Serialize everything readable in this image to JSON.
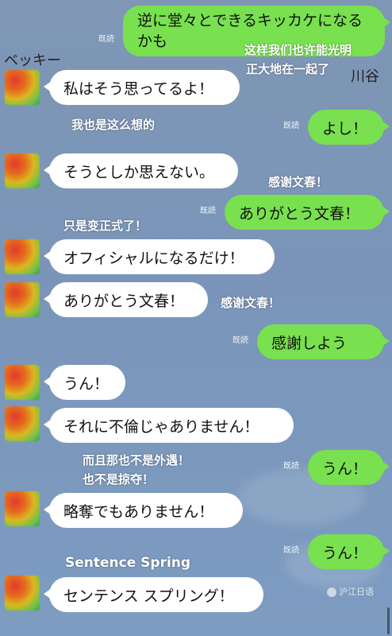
{
  "read_label": "既読",
  "speakers": {
    "left": "ベッキー",
    "right": "川谷"
  },
  "messages": {
    "m1": "逆に堂々とできるキッカケになるかも",
    "m2": "私はそう思ってるよ！",
    "m3": "よし！",
    "m4": "そうとしか思えない。",
    "m5": "ありがとう文春！",
    "m6": "オフィシャルになるだけ！",
    "m7": "ありがとう文春！",
    "m8": "感謝しよう",
    "m9": "うん！",
    "m10": "それに不倫じゃありません！",
    "m11": "うん！",
    "m12": "略奪でもありません！",
    "m13": "うん！",
    "m14": "センテンス スプリング！"
  },
  "subtitles": {
    "s1a": "这样我们也许能光明",
    "s1b": "正大地在一起了",
    "s2": "我也是这么想的",
    "s3": "感谢文春！",
    "s4": "只是变正式了！",
    "s5": "感谢文春！",
    "s6a": "而且那也不是外遇！",
    "s6b": "也不是掠夺！",
    "s7": "Sentence Spring"
  },
  "watermark": "沪江日语",
  "colors": {
    "incoming": "#ffffff",
    "outgoing": "#79e04f",
    "background": "#7d97b8"
  },
  "icons": {
    "avatar": "avatar-image",
    "watermark": "logo-icon"
  }
}
